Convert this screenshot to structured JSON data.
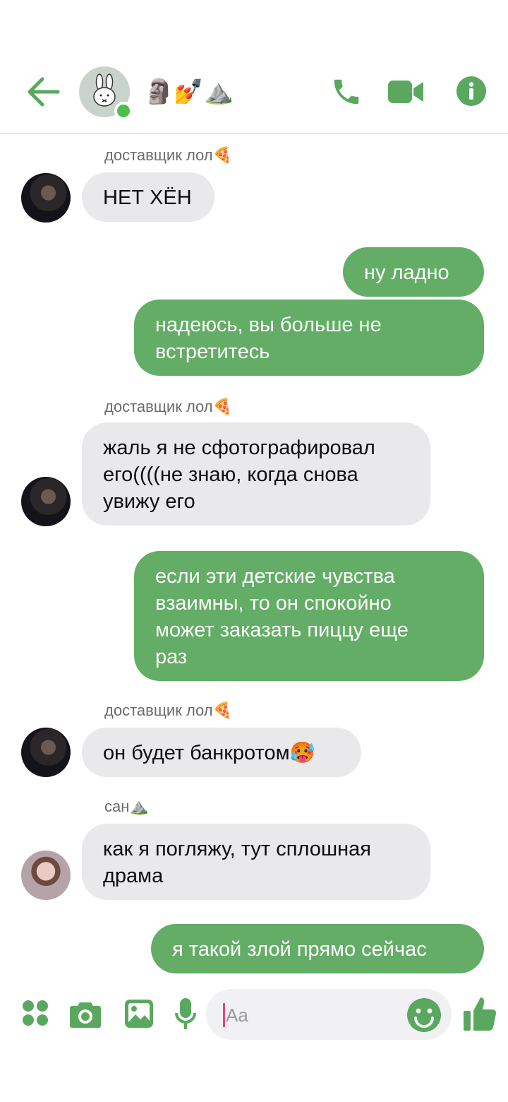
{
  "header": {
    "title": "🗿💅⛰️",
    "accent_color": "#5aa85f"
  },
  "icons": {
    "back": "arrow-left-icon",
    "call": "phone-icon",
    "video": "video-camera-icon",
    "info": "info-icon",
    "apps": "grid-dots-icon",
    "camera": "camera-icon",
    "gallery": "image-icon",
    "mic": "microphone-icon",
    "emoji": "smiley-icon",
    "like": "thumbs-up-icon"
  },
  "messages": [
    {
      "sender": "доставщик лол🍕",
      "text": "НЕТ ХЁН",
      "direction": "incoming"
    },
    {
      "text": "ну ладно",
      "direction": "outgoing"
    },
    {
      "text": "надеюсь, вы больше не\nвстретитесь",
      "direction": "outgoing"
    },
    {
      "sender": "доставщик лол🍕",
      "text": "жаль я не сфотографировал\nего((((не знаю, когда снова\nувижу его",
      "direction": "incoming"
    },
    {
      "text": "если эти детские чувства\nвзаимны, то он спокойно\nможет заказать пиццу еще\nраз",
      "direction": "outgoing"
    },
    {
      "sender": "доставщик лол🍕",
      "text": "он будет банкротом🥵",
      "direction": "incoming"
    },
    {
      "sender": "сан⛰️",
      "text": "как я погляжу, тут сплошная\nдрама",
      "direction": "incoming"
    },
    {
      "text": "я такой злой прямо сейчас",
      "direction": "outgoing"
    }
  ],
  "composer": {
    "placeholder": "Aa"
  }
}
